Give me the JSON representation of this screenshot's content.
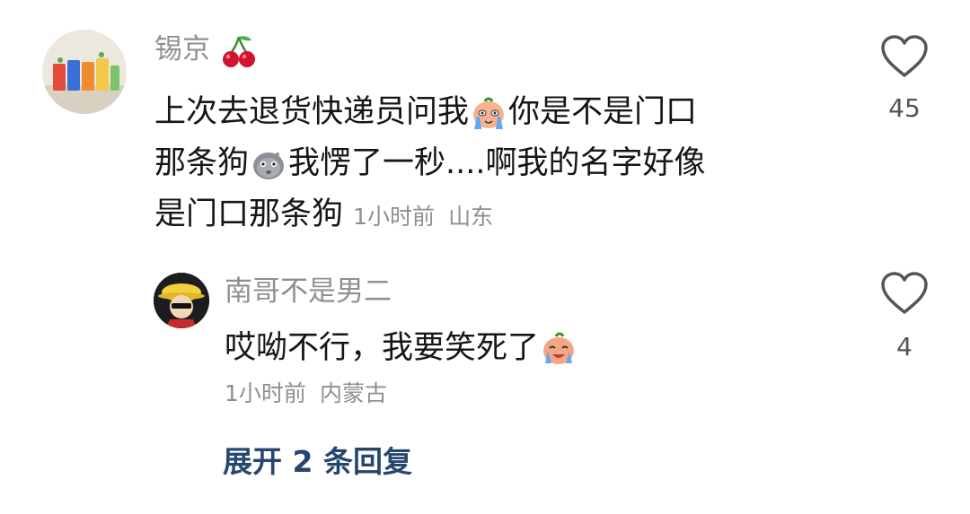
{
  "comment": {
    "author": "锡京",
    "author_emoji_icon": "cherry-icon",
    "line1_a": "上次去退货快递员问我",
    "line1_b": "你是不是门口",
    "line2_a": "那条狗",
    "line2_b": "我愣了一秒....啊我的名字好像",
    "line3": "是门口那条狗",
    "time": "1小时前",
    "location": "山东",
    "likes": "45"
  },
  "reply": {
    "author": "南哥不是男二",
    "text": "哎呦不行，我要笑死了",
    "time": "1小时前",
    "location": "内蒙古",
    "likes": "4"
  },
  "expand_replies": "展开 2 条回复",
  "colors": {
    "text": "#161616",
    "muted": "#8f8f8f",
    "link": "#27466f",
    "heart_stroke": "#555555"
  }
}
